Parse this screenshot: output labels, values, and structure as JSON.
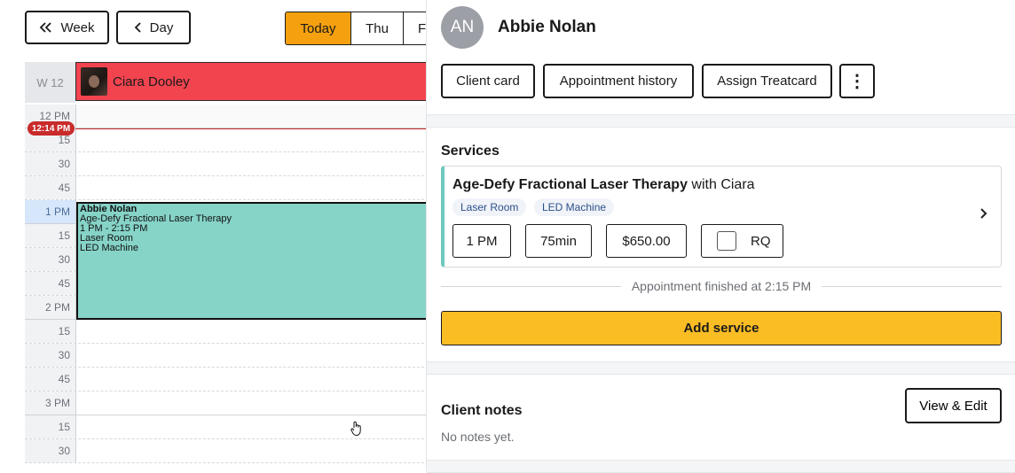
{
  "calendar": {
    "week_btn": "Week",
    "day_btn": "Day",
    "today_btn": "Today",
    "thu_btn": "Thu",
    "f_btn": "F",
    "week_label": "W 12",
    "staff_name": "Ciara Dooley",
    "now_pill": "12:14 PM",
    "times": [
      "12 PM",
      "15",
      "30",
      "45",
      "1 PM",
      "15",
      "30",
      "45",
      "2 PM",
      "15",
      "30",
      "45",
      "3 PM",
      "15",
      "30"
    ],
    "appointment": {
      "client": "Abbie Nolan",
      "service": "Age-Defy Fractional Laser Therapy",
      "time": "1 PM - 2:15 PM",
      "room": "Laser Room",
      "machine": "LED Machine",
      "color": "#86d3c7"
    }
  },
  "panel": {
    "avatar_initials": "AN",
    "client_name": "Abbie Nolan",
    "buttons": {
      "client_card": "Client card",
      "appointment_history": "Appointment history",
      "assign_treatcard": "Assign Treatcard",
      "more": "⋮"
    },
    "services_title": "Services",
    "service": {
      "name": "Age-Defy Fractional Laser Therapy",
      "with": "with Ciara",
      "tags": [
        "Laser Room",
        "LED Machine"
      ],
      "start": "1 PM",
      "duration": "75min",
      "price": "$650.00",
      "rq": "RQ"
    },
    "finished_text": "Appointment finished at 2:15 PM",
    "add_service": "Add service",
    "notes_title": "Client notes",
    "view_edit": "View & Edit",
    "no_notes": "No notes yet."
  },
  "colors": {
    "today_accent": "#f5a10f",
    "staff_bar": "#f2444f",
    "add_service": "#fbbd24",
    "now_indicator": "#c92b2b"
  }
}
